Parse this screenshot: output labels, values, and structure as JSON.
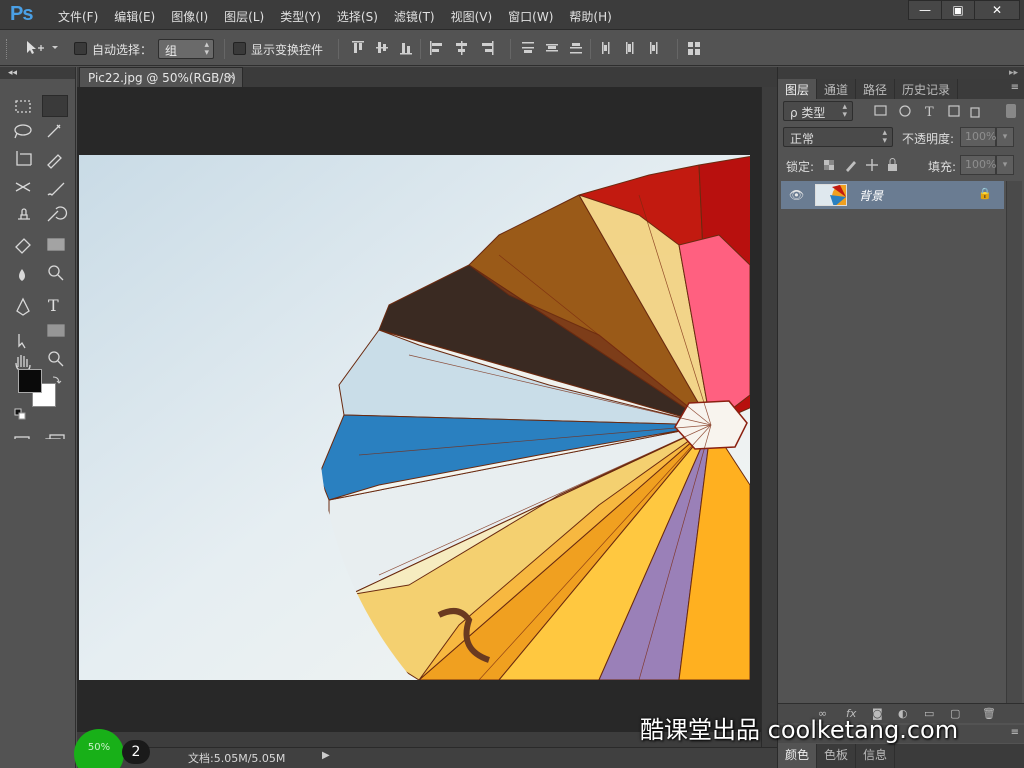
{
  "app": {
    "logo": "Ps"
  },
  "menu": [
    "文件(F)",
    "编辑(E)",
    "图像(I)",
    "图层(L)",
    "类型(Y)",
    "选择(S)",
    "滤镜(T)",
    "视图(V)",
    "窗口(W)",
    "帮助(H)"
  ],
  "window_controls": {
    "minimize": "—",
    "maximize": "▣",
    "close": "✕"
  },
  "options": {
    "auto_select_label": "自动选择：",
    "auto_select_checked": false,
    "auto_select_value": "组",
    "show_transform_label": "显示变换控件",
    "show_transform_checked": false
  },
  "document": {
    "tab_title": "Pic22.jpg @ 50%(RGB/8)",
    "tab_close": "×",
    "zoom_badge": "50%",
    "step_badge": "2",
    "doc_info": "文档:5.05M/5.05M",
    "info_arrow": "▶"
  },
  "layers_panel": {
    "tabs": [
      "图层",
      "通道",
      "路径",
      "历史记录"
    ],
    "active_tab": "图层",
    "filter_label": "ρ 类型",
    "blend_mode": "正常",
    "opacity_label": "不透明度:",
    "opacity_value": "100%",
    "lock_label": "锁定:",
    "fill_label": "填充:",
    "fill_value": "100%",
    "layer_name": "背景",
    "panel_menu": "≡"
  },
  "bottom_panel": {
    "tabs": [
      "颜色",
      "色板",
      "信息"
    ],
    "active_tab": "颜色"
  },
  "watermark": "酷课堂出品 coolketang.com",
  "colors": {
    "foreground": "#0a0a0a",
    "background": "#ffffff",
    "ps_blue": "#4aa0e6",
    "zoom_badge": "#18b018",
    "selected_layer": "#6a7c92"
  }
}
